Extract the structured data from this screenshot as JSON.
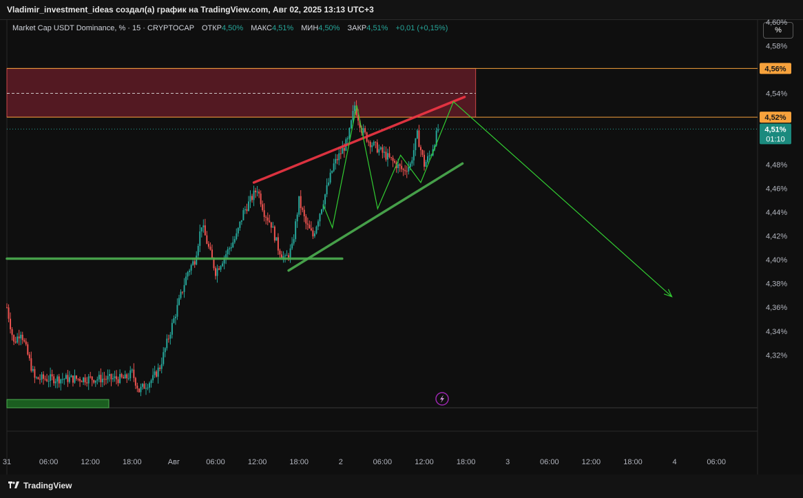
{
  "header": {
    "author_line": "Vladimir_investment_ideas создал(а) график на TradingView.com, Авг 02, 2025 13:13 UTC+3"
  },
  "legend": {
    "symbol": "Market Cap USDT Dominance, % · 15 · CRYPTOCAP",
    "open_label": "ОТКР",
    "open_value": "4,50%",
    "high_label": "МАКС",
    "high_value": "4,51%",
    "low_label": "МИН",
    "low_value": "4,50%",
    "close_label": "ЗАКР",
    "close_value": "4,51%",
    "change": "+0,01 (+0,15%)"
  },
  "scale_button": "%",
  "price_labels": {
    "upper_zone": "4,56%",
    "lower_zone": "4,52%",
    "last_price": "4,51%",
    "countdown": "01:10"
  },
  "footer": {
    "brand": "TradingView"
  },
  "colors": {
    "up": "#26a69a",
    "down": "#ef5350",
    "zone": "#6b1e2a",
    "zone_line": "#f7a23c",
    "resistance_line": "#f23645",
    "support_line": "#4caf50",
    "projection": "#32cd32"
  },
  "chart_data": {
    "type": "candlestick",
    "title": "",
    "y_unit": "%",
    "ylim": [
      4.3,
      4.61
    ],
    "y_ticks": [
      {
        "v": 4.32,
        "label": "4,32%"
      },
      {
        "v": 4.34,
        "label": "4,34%"
      },
      {
        "v": 4.36,
        "label": "4,36%"
      },
      {
        "v": 4.38,
        "label": "4,38%"
      },
      {
        "v": 4.4,
        "label": "4,40%"
      },
      {
        "v": 4.42,
        "label": "4,42%"
      },
      {
        "v": 4.44,
        "label": "4,44%"
      },
      {
        "v": 4.46,
        "label": "4,46%"
      },
      {
        "v": 4.48,
        "label": "4,48%"
      },
      {
        "v": 4.54,
        "label": "4,54%"
      },
      {
        "v": 4.58,
        "label": "4,58%"
      },
      {
        "v": 4.6,
        "label": "4,60%"
      }
    ],
    "x_ticks": [
      {
        "t": 0,
        "label": "31"
      },
      {
        "t": 6,
        "label": "06:00"
      },
      {
        "t": 12,
        "label": "12:00"
      },
      {
        "t": 18,
        "label": "18:00"
      },
      {
        "t": 24,
        "label": "Авг"
      },
      {
        "t": 30,
        "label": "06:00"
      },
      {
        "t": 36,
        "label": "12:00"
      },
      {
        "t": 42,
        "label": "18:00"
      },
      {
        "t": 48,
        "label": "2"
      },
      {
        "t": 54,
        "label": "06:00"
      },
      {
        "t": 60,
        "label": "12:00"
      },
      {
        "t": 66,
        "label": "18:00"
      },
      {
        "t": 72,
        "label": "3"
      },
      {
        "t": 78,
        "label": "06:00"
      },
      {
        "t": 84,
        "label": "12:00"
      },
      {
        "t": 90,
        "label": "18:00"
      },
      {
        "t": 96,
        "label": "4"
      },
      {
        "t": 102,
        "label": "06:00"
      }
    ],
    "price_path": [
      [
        0,
        4.36
      ],
      [
        1,
        4.33
      ],
      [
        2,
        4.34
      ],
      [
        3,
        4.32
      ],
      [
        4,
        4.3
      ],
      [
        17,
        4.3
      ],
      [
        18,
        4.305
      ],
      [
        19,
        4.29
      ],
      [
        21,
        4.3
      ],
      [
        22,
        4.31
      ],
      [
        23,
        4.33
      ],
      [
        24,
        4.35
      ],
      [
        25,
        4.37
      ],
      [
        26,
        4.39
      ],
      [
        27,
        4.4
      ],
      [
        28,
        4.43
      ],
      [
        29,
        4.41
      ],
      [
        30,
        4.39
      ],
      [
        31,
        4.4
      ],
      [
        32,
        4.41
      ],
      [
        33,
        4.42
      ],
      [
        34,
        4.44
      ],
      [
        35,
        4.45
      ],
      [
        36,
        4.46
      ],
      [
        37,
        4.44
      ],
      [
        38,
        4.43
      ],
      [
        39,
        4.41
      ],
      [
        40,
        4.4
      ],
      [
        41,
        4.41
      ],
      [
        42,
        4.45
      ],
      [
        43,
        4.43
      ],
      [
        44,
        4.42
      ],
      [
        45,
        4.44
      ],
      [
        46,
        4.46
      ],
      [
        47,
        4.48
      ],
      [
        48,
        4.49
      ],
      [
        49,
        4.5
      ],
      [
        50,
        4.53
      ],
      [
        51,
        4.51
      ],
      [
        52,
        4.5
      ],
      [
        53,
        4.495
      ],
      [
        54,
        4.49
      ],
      [
        55,
        4.485
      ],
      [
        56,
        4.48
      ],
      [
        57,
        4.475
      ],
      [
        58,
        4.48
      ],
      [
        59,
        4.505
      ],
      [
        60,
        4.48
      ],
      [
        61,
        4.49
      ],
      [
        62,
        4.51
      ]
    ],
    "zones": [
      {
        "from": 4.52,
        "to": 4.561,
        "t_end": 67.4,
        "mid": 4.54
      }
    ],
    "horizontal_levels": [
      4.561,
      4.52
    ],
    "trend_lines": [
      {
        "name": "resistance",
        "points": [
          [
            35.5,
            4.465
          ],
          [
            65.8,
            4.537
          ]
        ]
      },
      {
        "name": "support",
        "points": [
          [
            40.5,
            4.391
          ],
          [
            65.5,
            4.481
          ]
        ]
      },
      {
        "name": "base",
        "points": [
          [
            0,
            4.401
          ],
          [
            48.2,
            4.401
          ]
        ]
      }
    ],
    "projection_path": [
      [
        45.5,
        4.446
      ],
      [
        46.8,
        4.427
      ],
      [
        50.3,
        4.53
      ],
      [
        53.3,
        4.443
      ],
      [
        56.6,
        4.488
      ],
      [
        59.5,
        4.465
      ],
      [
        64.2,
        4.533
      ],
      [
        95.6,
        4.369
      ]
    ],
    "last_price": 4.51
  }
}
